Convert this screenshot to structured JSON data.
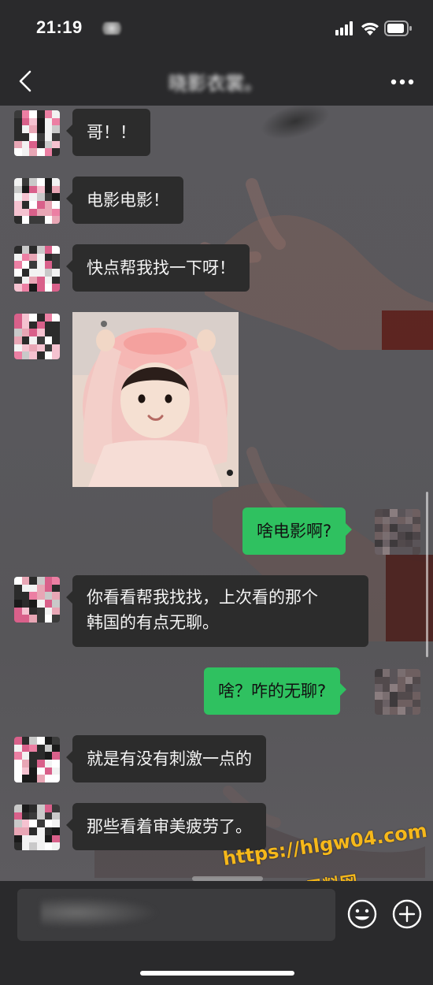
{
  "status_bar": {
    "time": "21:19"
  },
  "nav": {
    "title_blurred": "晓影衣裳",
    "title_suffix": "。"
  },
  "messages": [
    {
      "side": "left",
      "text": "哥！！"
    },
    {
      "side": "left",
      "text": "电影电影！"
    },
    {
      "side": "left",
      "text": "快点帮我找一下呀！"
    },
    {
      "side": "left",
      "type": "image",
      "alt": "photo of a child in a pink hoodie"
    },
    {
      "side": "right",
      "text": "啥电影啊?"
    },
    {
      "side": "left",
      "lines": [
        "你看看帮我找找，上次看的那个",
        "韩国的有点无聊。"
      ]
    },
    {
      "side": "right",
      "text": "啥？咋的无聊?"
    },
    {
      "side": "left",
      "text": "就是有没有刺激一点的"
    },
    {
      "side": "left",
      "text": "那些看着审美疲劳了。"
    }
  ],
  "watermark": {
    "url": "https://hlgw04.com",
    "site": "黑料网"
  },
  "colors": {
    "bubble_left": "#2c2c2c",
    "bubble_right": "#2fc160",
    "bar": "#2a2a2c",
    "watermark": "#f6b81a"
  },
  "icons": [
    "back-icon",
    "more-icon",
    "signal-icon",
    "wifi-icon",
    "battery-icon",
    "emoji-icon",
    "add-icon"
  ]
}
